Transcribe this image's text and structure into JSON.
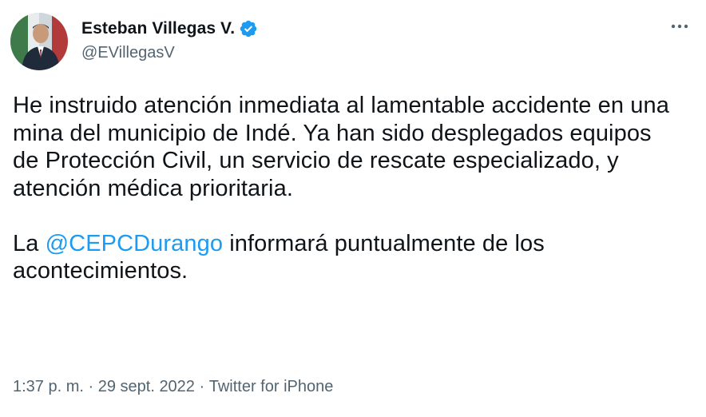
{
  "author": {
    "display_name": "Esteban Villegas V.",
    "handle": "@EVillegasV",
    "verified": true,
    "avatar_icon": "profile-photo"
  },
  "tweet": {
    "paragraph1": "He instruido atención inmediata al lamentable accidente en una mina del municipio de Indé. Ya han sido desplegados equipos de Protección Civil, un servicio de rescate especializado, y atención médica prioritaria.",
    "paragraph2_prefix": "La ",
    "mention": "@CEPCDurango",
    "paragraph2_suffix": " informará puntualmente de los acontecimientos."
  },
  "meta": {
    "time": "1:37 p. m.",
    "separator": " · ",
    "date": "29 sept. 2022",
    "source": "Twitter for iPhone"
  },
  "colors": {
    "text": "#0f1419",
    "secondary": "#536471",
    "accent": "#1d9bf0"
  }
}
